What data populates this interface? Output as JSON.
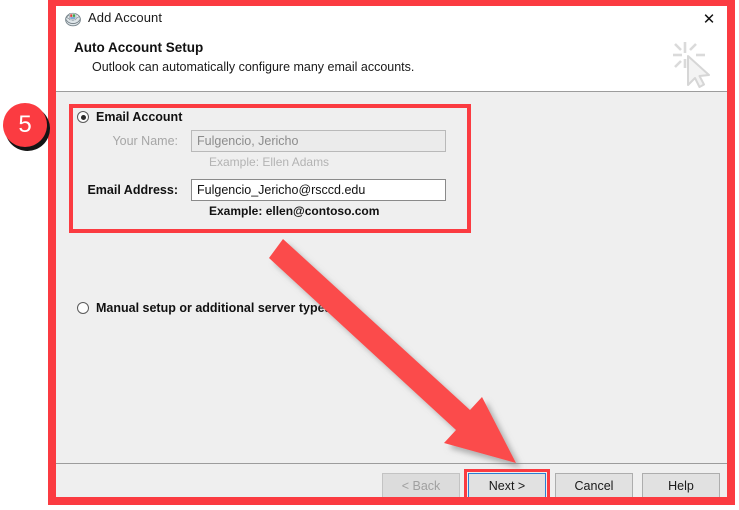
{
  "window": {
    "title": "Add Account",
    "app_icon": "outlook-globe-icon",
    "close_label": "✕"
  },
  "header": {
    "title": "Auto Account Setup",
    "subtitle": "Outlook can automatically configure many email accounts.",
    "watermark_icon": "cursor-sparkle-icon"
  },
  "form": {
    "email_account_option": "Email Account",
    "your_name_label": "Your Name:",
    "your_name_value": "Fulgencio, Jericho",
    "your_name_example": "Example: Ellen Adams",
    "email_address_label": "Email Address:",
    "email_address_value": "Fulgencio_Jericho@rsccd.edu",
    "email_address_example": "Example: ellen@contoso.com",
    "manual_setup_option": "Manual setup or additional server types"
  },
  "footer": {
    "back_label": "< Back",
    "next_label": "Next >",
    "cancel_label": "Cancel",
    "help_label": "Help"
  },
  "annotation": {
    "step_number": "5",
    "accent_color": "#fb3b41",
    "focus_color": "#2b7fd4"
  }
}
